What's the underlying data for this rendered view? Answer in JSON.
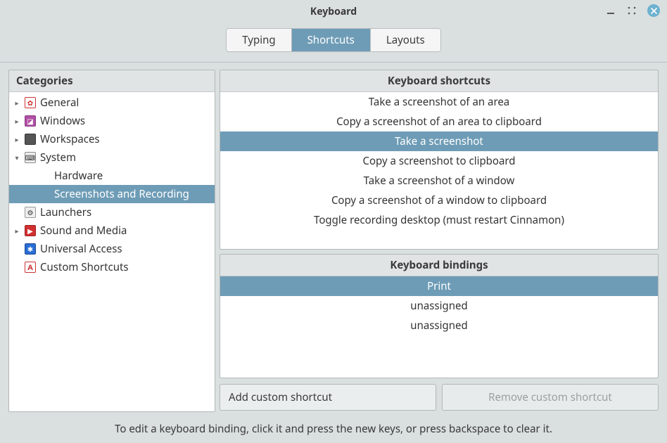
{
  "window": {
    "title": "Keyboard"
  },
  "tabs": {
    "typing": "Typing",
    "shortcuts": "Shortcuts",
    "layouts": "Layouts",
    "active": "shortcuts"
  },
  "categories": {
    "header": "Categories",
    "items": [
      {
        "id": "general",
        "label": "General",
        "icon": "general",
        "expandable": true,
        "expanded": false,
        "depth": 0
      },
      {
        "id": "windows",
        "label": "Windows",
        "icon": "windows",
        "expandable": true,
        "expanded": false,
        "depth": 0
      },
      {
        "id": "workspaces",
        "label": "Workspaces",
        "icon": "workspaces",
        "expandable": true,
        "expanded": false,
        "depth": 0
      },
      {
        "id": "system",
        "label": "System",
        "icon": "system",
        "expandable": true,
        "expanded": true,
        "depth": 0
      },
      {
        "id": "hardware",
        "label": "Hardware",
        "icon": null,
        "expandable": false,
        "depth": 1
      },
      {
        "id": "screenshots",
        "label": "Screenshots and Recording",
        "icon": null,
        "expandable": false,
        "depth": 1,
        "selected": true
      },
      {
        "id": "launchers",
        "label": "Launchers",
        "icon": "launchers",
        "expandable": false,
        "depth": 0
      },
      {
        "id": "sound",
        "label": "Sound and Media",
        "icon": "sound",
        "expandable": true,
        "expanded": false,
        "depth": 0
      },
      {
        "id": "access",
        "label": "Universal Access",
        "icon": "access",
        "expandable": false,
        "depth": 0
      },
      {
        "id": "custom",
        "label": "Custom Shortcuts",
        "icon": "custom",
        "expandable": false,
        "depth": 0
      }
    ]
  },
  "shortcuts": {
    "header": "Keyboard shortcuts",
    "items": [
      {
        "label": "Take a screenshot of an area"
      },
      {
        "label": "Copy a screenshot of an area to clipboard"
      },
      {
        "label": "Take a screenshot",
        "selected": true
      },
      {
        "label": "Copy a screenshot to clipboard"
      },
      {
        "label": "Take a screenshot of a window"
      },
      {
        "label": "Copy a screenshot of a window to clipboard"
      },
      {
        "label": "Toggle recording desktop (must restart Cinnamon)"
      }
    ]
  },
  "bindings": {
    "header": "Keyboard bindings",
    "items": [
      {
        "label": "Print",
        "selected": true
      },
      {
        "label": "unassigned"
      },
      {
        "label": "unassigned"
      }
    ]
  },
  "buttons": {
    "add": "Add custom shortcut",
    "remove": "Remove custom shortcut",
    "remove_enabled": false
  },
  "footer": "To edit a keyboard binding, click it and press the new keys, or press backspace to clear it."
}
